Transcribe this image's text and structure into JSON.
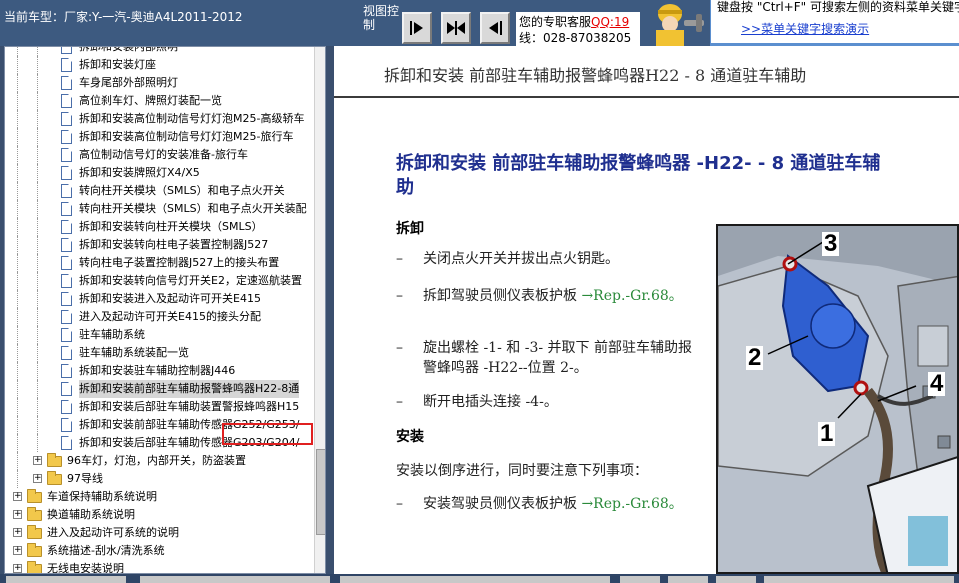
{
  "header": {
    "car_label": "当前车型：厂家:Y-一汽-奥迪A4L2011-2012",
    "view_control_label": "视图控制",
    "service_line1_prefix": "您的专职客服",
    "service_qq": "QQ:19",
    "service_line2": "线：028-87038205",
    "hint_text": "键盘按 \"Ctrl+F\" 可搜索左侧的资料菜单关键字！",
    "hint_link": ">>菜单关键字搜索演示"
  },
  "tree": {
    "items": [
      {
        "label": "拆卸和安装内部照明",
        "type": "doc",
        "depth": 3
      },
      {
        "label": "拆卸和安装灯座",
        "type": "doc",
        "depth": 3
      },
      {
        "label": "车身尾部外部照明灯",
        "type": "doc",
        "depth": 3
      },
      {
        "label": "高位刹车灯、牌照灯装配一览",
        "type": "doc",
        "depth": 3
      },
      {
        "label": "拆卸和安装高位制动信号灯灯泡M25-高级轿车",
        "type": "doc",
        "depth": 3
      },
      {
        "label": "拆卸和安装高位制动信号灯灯泡M25-旅行车",
        "type": "doc",
        "depth": 3
      },
      {
        "label": "高位制动信号灯的安装准备-旅行车",
        "type": "doc",
        "depth": 3
      },
      {
        "label": "拆卸和安装牌照灯X4/X5",
        "type": "doc",
        "depth": 3
      },
      {
        "label": "转向柱开关模块（SMLS）和电子点火开关",
        "type": "doc",
        "depth": 3
      },
      {
        "label": "转向柱开关模块（SMLS）和电子点火开关装配",
        "type": "doc",
        "depth": 3
      },
      {
        "label": "拆卸和安装转向柱开关模块（SMLS）",
        "type": "doc",
        "depth": 3
      },
      {
        "label": "拆卸和安装转向柱电子装置控制器J527",
        "type": "doc",
        "depth": 3
      },
      {
        "label": "转向柱电子装置控制器J527上的接头布置",
        "type": "doc",
        "depth": 3
      },
      {
        "label": "拆卸和安装转向信号灯开关E2，定速巡航装置",
        "type": "doc",
        "depth": 3
      },
      {
        "label": "拆卸和安装进入及起动许可开关E415",
        "type": "doc",
        "depth": 3
      },
      {
        "label": "进入及起动许可开关E415的接头分配",
        "type": "doc",
        "depth": 3
      },
      {
        "label": "驻车辅助系统",
        "type": "doc",
        "depth": 3
      },
      {
        "label": "驻车辅助系统装配一览",
        "type": "doc",
        "depth": 3
      },
      {
        "label": "拆卸和安装驻车辅助控制器J446",
        "type": "doc",
        "depth": 3
      },
      {
        "label": "拆卸和安装前部驻车辅助报警蜂鸣器H22-8通",
        "type": "doc",
        "depth": 3,
        "selected": true
      },
      {
        "label": "拆卸和安装后部驻车辅助装置警报蜂鸣器H15",
        "type": "doc",
        "depth": 3
      },
      {
        "label": "拆卸和安装前部驻车辅助传感器G252/G253/",
        "type": "doc",
        "depth": 3
      },
      {
        "label": "拆卸和安装后部驻车辅助传感器G203/G204/",
        "type": "doc",
        "depth": 3
      },
      {
        "label": "96车灯，灯泡，内部开关，防盗装置",
        "type": "folder",
        "depth": 2
      },
      {
        "label": "97导线",
        "type": "folder",
        "depth": 2
      },
      {
        "label": "车道保持辅助系统说明",
        "type": "folder",
        "depth": 1
      },
      {
        "label": "换道辅助系统说明",
        "type": "folder",
        "depth": 1
      },
      {
        "label": "进入及起动许可系统的说明",
        "type": "folder",
        "depth": 1
      },
      {
        "label": "系统描述-刮水/清洗系统",
        "type": "folder",
        "depth": 1
      },
      {
        "label": "无线电安装说明",
        "type": "folder",
        "depth": 1
      }
    ]
  },
  "content": {
    "top_title": "拆卸和安装 前部驻车辅助报警蜂鸣器H22 - 8 通道驻车辅助",
    "doc_title": "拆卸和安装 前部驻车辅助报警蜂鸣器 -H22- - 8 通道驻车辅助",
    "removal_heading": "拆卸",
    "removal_steps": [
      {
        "dash": "–",
        "text": "关闭点火开关并拔出点火钥匙。"
      },
      {
        "dash": "–",
        "text": "拆卸驾驶员侧仪表板护板 ",
        "ref": "→Rep.-Gr.68。"
      },
      {
        "dash": "–",
        "text": "旋出螺栓 -1- 和 -3- 并取下 前部驻车辅助报警蜂鸣器 -H22--位置 2-。"
      },
      {
        "dash": "–",
        "text": "断开电插头连接 -4-。"
      }
    ],
    "install_heading": "安装",
    "install_note": "安装以倒序进行，同时要注意下列事项：",
    "install_steps": [
      {
        "dash": "–",
        "text": "安装驾驶员侧仪表板护板 ",
        "ref": "→Rep.-Gr.68。"
      }
    ],
    "figure_callouts": [
      "1",
      "2",
      "3",
      "4"
    ]
  },
  "colors": {
    "header_bg": "#3d5a80",
    "title_blue": "#1f2f8f",
    "ref_green": "#2a8a3a",
    "part_blue": "#2f5fd0",
    "selection_red": "#e02020"
  },
  "icons": {
    "nav_next": "triangle-right-bar-icon",
    "nav_both": "double-triangle-icon",
    "nav_prev": "triangle-left-bar-icon",
    "doc": "document-icon",
    "folder": "folder-icon"
  }
}
